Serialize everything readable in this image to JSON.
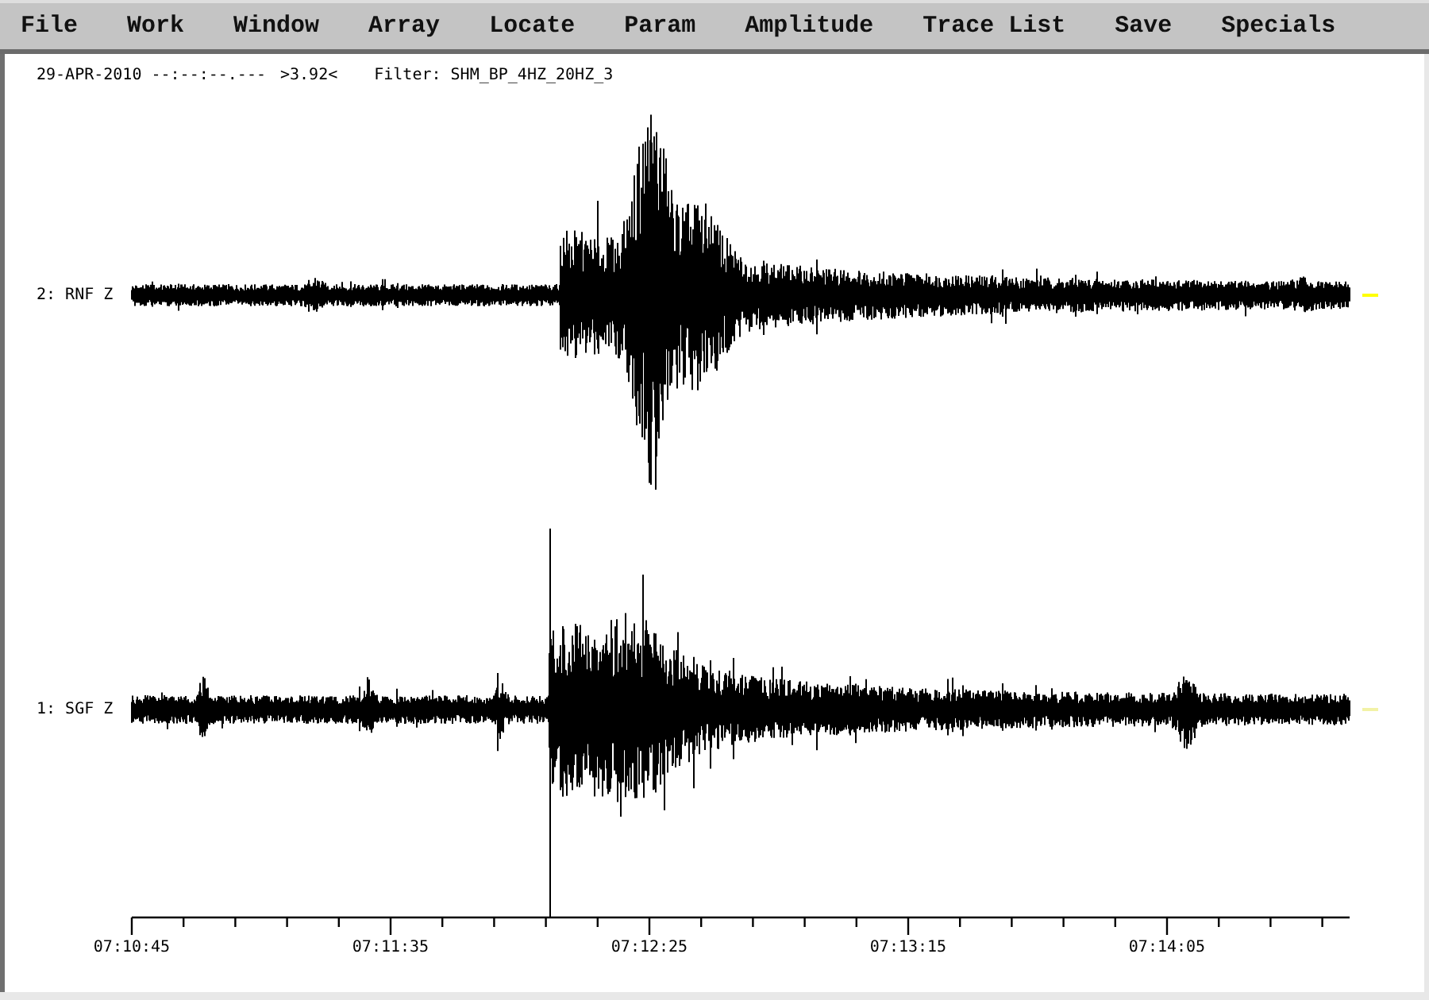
{
  "menu_bar": {
    "items": [
      "File",
      "Work",
      "Window",
      "Array",
      "Locate",
      "Param",
      "Amplitude",
      "Trace List",
      "Save",
      "Specials"
    ]
  },
  "header": {
    "date_time": "29-APR-2010 --:--:--.---",
    "reading": ">3.92<",
    "filter": "Filter: SHM_BP_4HZ_20HZ_3"
  },
  "traces": [
    {
      "label": "2: RNF Z",
      "color": "#ffff00"
    },
    {
      "label": "1: SGF Z",
      "color": "#f2f2a6"
    }
  ],
  "time_axis": {
    "labels": [
      "07:10:45",
      "07:11:35",
      "07:12:25",
      "07:13:15",
      "07:14:05"
    ]
  }
}
